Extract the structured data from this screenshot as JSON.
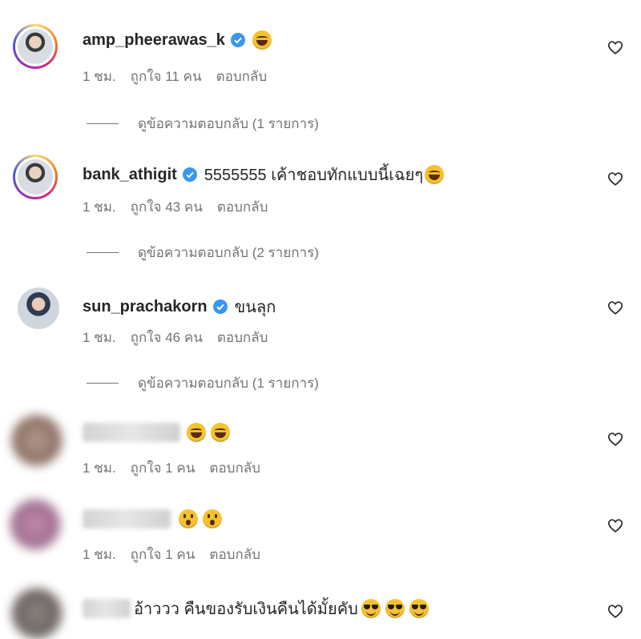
{
  "comments": [
    {
      "username": "amp_pheerawas_k",
      "verified": true,
      "text": "",
      "emojis": [
        "face-with-tears-of-joy"
      ],
      "time": "1 ชม.",
      "likes": "ถูกใจ 11 คน",
      "reply": "ตอบกลับ",
      "view_replies": "ดูข้อความตอบกลับ (1 รายการ)"
    },
    {
      "username": "bank_athigit",
      "verified": true,
      "text": "5555555 เค้าชอบทักแบบนี้เฉยๆ",
      "emojis": [
        "face-with-tears-of-joy"
      ],
      "time": "1 ชม.",
      "likes": "ถูกใจ 43 คน",
      "reply": "ตอบกลับ",
      "view_replies": "ดูข้อความตอบกลับ (2 รายการ)"
    },
    {
      "username": "sun_prachakorn",
      "verified": true,
      "text": "ขนลุก",
      "emojis": [],
      "time": "1 ชม.",
      "likes": "ถูกใจ 46 คน",
      "reply": "ตอบกลับ",
      "view_replies": "ดูข้อความตอบกลับ (1 รายการ)"
    },
    {
      "username": "",
      "verified": false,
      "text": "",
      "emojis": [
        "face-with-tears-of-joy",
        "face-with-tears-of-joy"
      ],
      "time": "1 ชม.",
      "likes": "ถูกใจ 1 คน",
      "reply": "ตอบกลับ"
    },
    {
      "username": "",
      "verified": false,
      "text": "",
      "emojis": [
        "astonished-face",
        "astonished-face"
      ],
      "time": "1 ชม.",
      "likes": "ถูกใจ 1 คน",
      "reply": "ตอบกลับ"
    },
    {
      "username": "",
      "verified": false,
      "text": "อ้าววว คืนของรับเงินคืนได้มั้ยคับ",
      "emojis": [
        "smiling-face-with-sunglasses",
        "smiling-face-with-sunglasses",
        "smiling-face-with-sunglasses"
      ]
    }
  ],
  "icons": {
    "like": "heart-outline-icon",
    "verified": "verified-badge-icon"
  },
  "colors": {
    "verified": "#3897f0",
    "meta_text": "#737373",
    "primary_text": "#262626"
  }
}
